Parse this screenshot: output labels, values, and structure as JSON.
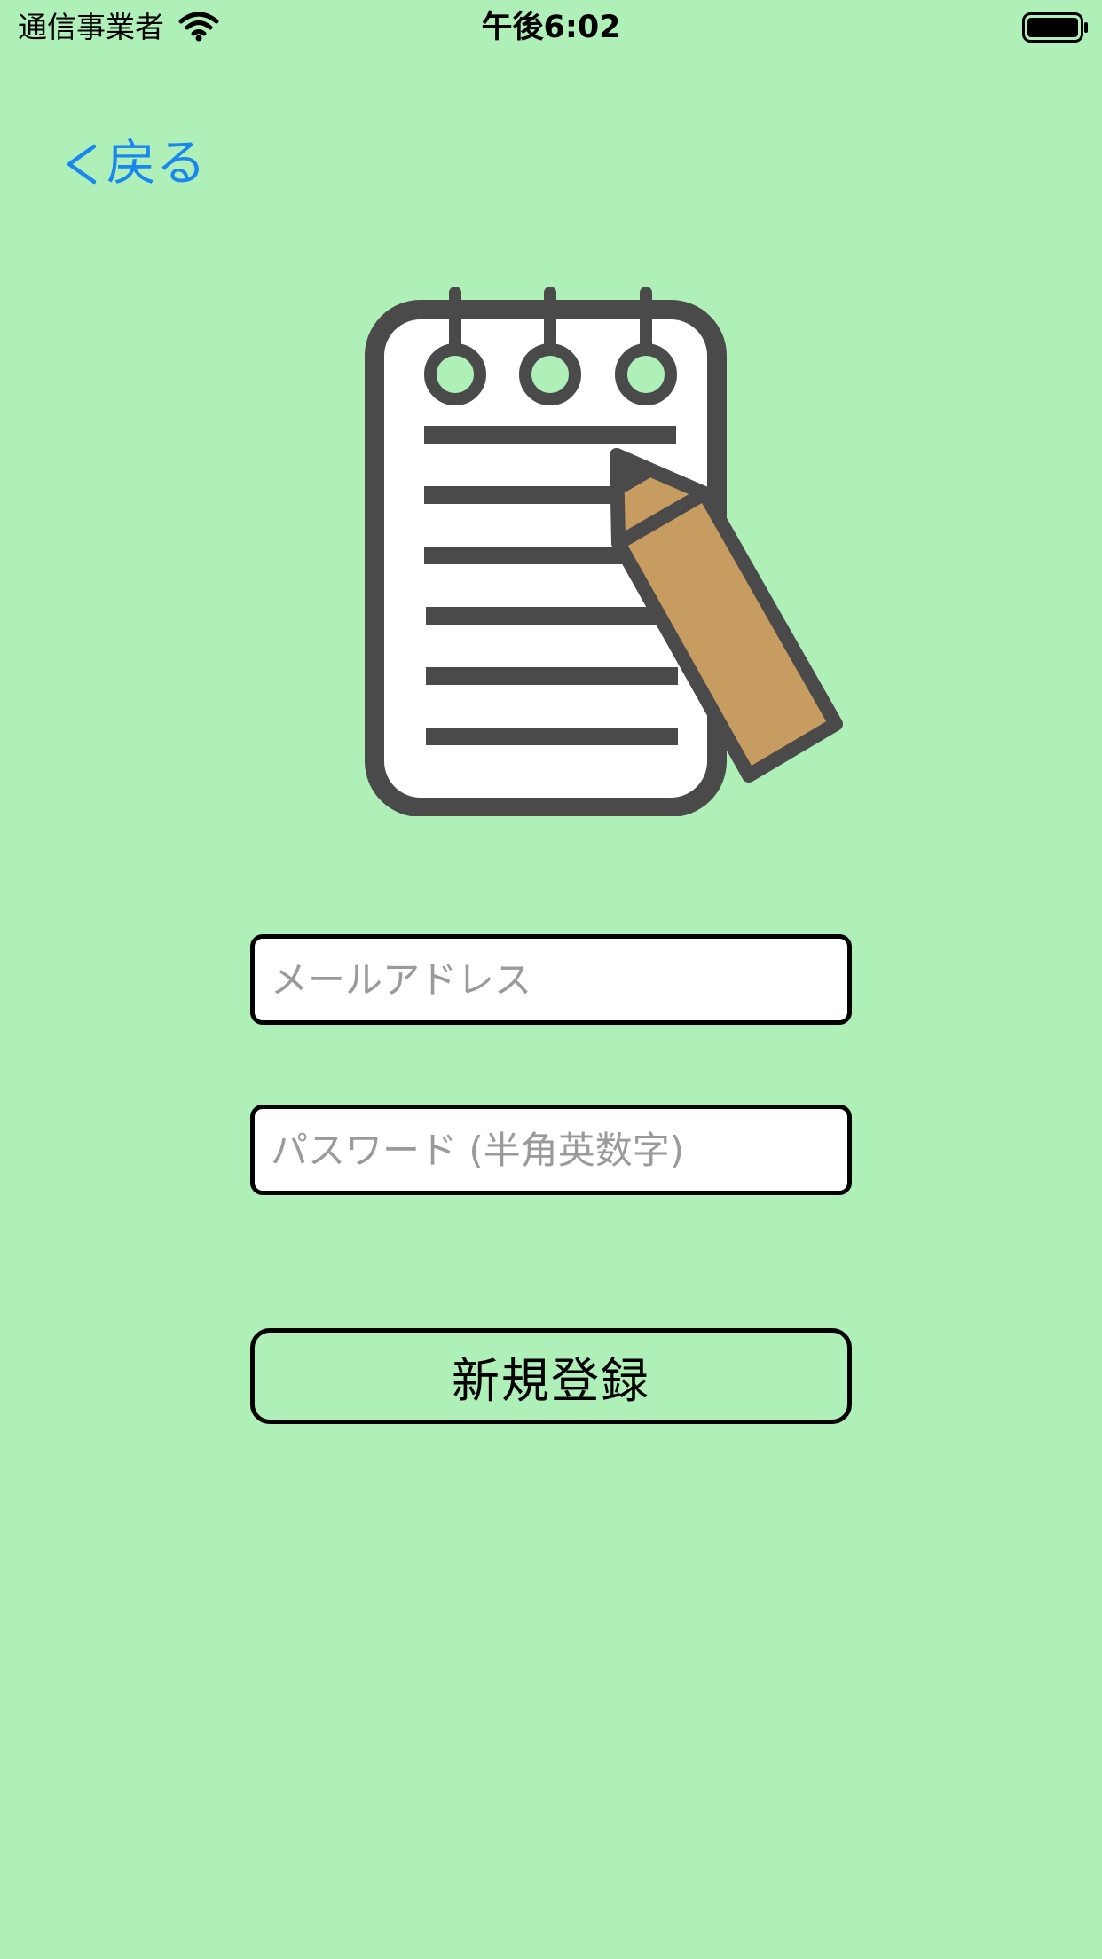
{
  "status_bar": {
    "carrier": "通信事業者",
    "time": "午後6:02"
  },
  "nav": {
    "back_label": "戻る"
  },
  "form": {
    "email_placeholder": "メールアドレス",
    "password_placeholder": "パスワード (半角英数字)",
    "email_value": "",
    "password_value": ""
  },
  "actions": {
    "signup_label": "新規登録"
  },
  "colors": {
    "background": "#aff0b8",
    "accent": "#1a86f0",
    "icon_dark": "#4a4a4a",
    "pencil": "#c79c61"
  },
  "icons": {
    "logo": "notepad-pencil-icon",
    "back": "chevron-left-icon",
    "wifi": "wifi-icon",
    "battery": "battery-icon"
  }
}
